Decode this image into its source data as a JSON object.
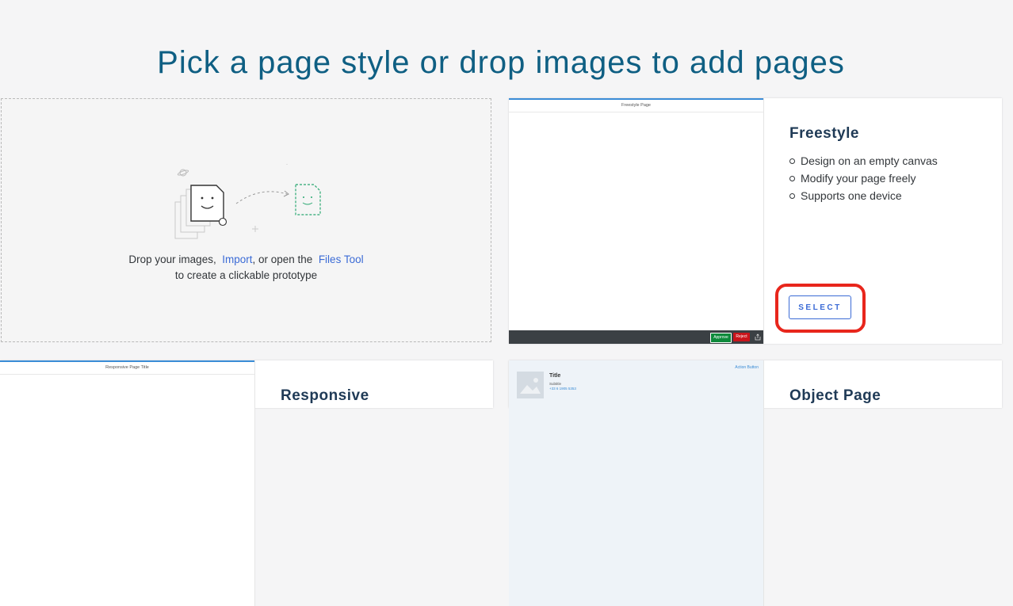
{
  "page": {
    "title": "Pick a page style or drop images to add pages"
  },
  "dropzone": {
    "text_before": "Drop your images,",
    "import_link": "Import",
    "text_middle": ", or open the",
    "files_tool_link": "Files Tool",
    "text_line2": "to create a clickable prototype"
  },
  "cards": {
    "freestyle": {
      "preview_header": "Freestyle Page",
      "preview_approve": "Approve",
      "preview_reject": "Reject",
      "title": "Freestyle",
      "features": [
        "Design on an empty canvas",
        "Modify your page freely",
        "Supports one device"
      ],
      "select_label": "SELECT"
    },
    "responsive": {
      "preview_header": "Responsive Page Title",
      "title": "Responsive"
    },
    "object_page": {
      "preview_action": "Action Button",
      "preview_title": "Title",
      "preview_subtitle": "Subtitle",
      "preview_phone": "+33 6 1905 5353",
      "title": "Object Page"
    }
  },
  "colors": {
    "title": "#0f5f83",
    "link": "#3b6bd6",
    "highlight": "#e8261c",
    "approve": "#0d8a3b",
    "reject": "#c9141b"
  }
}
